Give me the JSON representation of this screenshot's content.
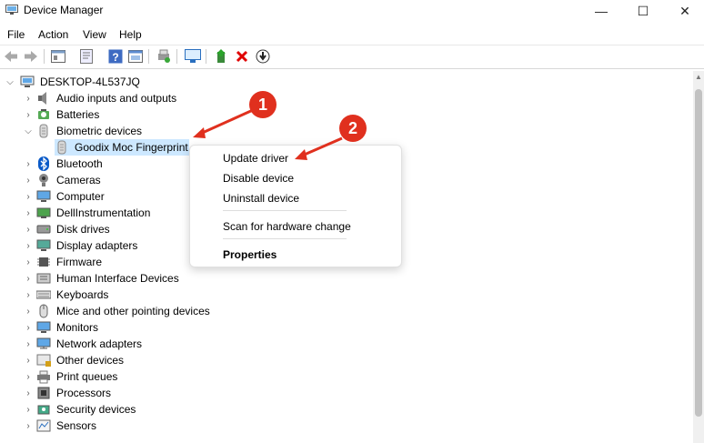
{
  "window": {
    "title": "Device Manager"
  },
  "window_controls": {
    "minimize": "—",
    "maximize": "☐",
    "close": "✕"
  },
  "menu": [
    "File",
    "Action",
    "View",
    "Help"
  ],
  "tree": {
    "root": "DESKTOP-4L537JQ",
    "items": [
      {
        "label": "Audio inputs and outputs",
        "icon": "speaker-icon"
      },
      {
        "label": "Batteries",
        "icon": "battery-icon"
      },
      {
        "label": "Biometric devices",
        "icon": "fingerprint-icon",
        "expanded": true
      },
      {
        "label": "Goodix Moc Fingerprint",
        "icon": "fingerprint-icon",
        "child": true,
        "selected": true
      },
      {
        "label": "Bluetooth",
        "icon": "bluetooth-icon"
      },
      {
        "label": "Cameras",
        "icon": "camera-icon"
      },
      {
        "label": "Computer",
        "icon": "monitor-icon"
      },
      {
        "label": "DellInstrumentation",
        "icon": "device-icon"
      },
      {
        "label": "Disk drives",
        "icon": "disk-icon"
      },
      {
        "label": "Display adapters",
        "icon": "display-adapter-icon"
      },
      {
        "label": "Firmware",
        "icon": "chip-icon"
      },
      {
        "label": "Human Interface Devices",
        "icon": "hid-icon"
      },
      {
        "label": "Keyboards",
        "icon": "keyboard-icon"
      },
      {
        "label": "Mice and other pointing devices",
        "icon": "mouse-icon"
      },
      {
        "label": "Monitors",
        "icon": "monitor-icon"
      },
      {
        "label": "Network adapters",
        "icon": "network-icon"
      },
      {
        "label": "Other devices",
        "icon": "unknown-device-icon"
      },
      {
        "label": "Print queues",
        "icon": "printer-icon"
      },
      {
        "label": "Processors",
        "icon": "cpu-icon"
      },
      {
        "label": "Security devices",
        "icon": "security-icon"
      },
      {
        "label": "Sensors",
        "icon": "sensor-icon"
      }
    ]
  },
  "context_menu": {
    "items": [
      "Update driver",
      "Disable device",
      "Uninstall device",
      "Scan for hardware change",
      "Properties"
    ]
  },
  "callouts": [
    "1",
    "2"
  ],
  "colors": {
    "callout": "#e0301e",
    "selection": "#cde8ff",
    "accent": "#0078d4"
  }
}
